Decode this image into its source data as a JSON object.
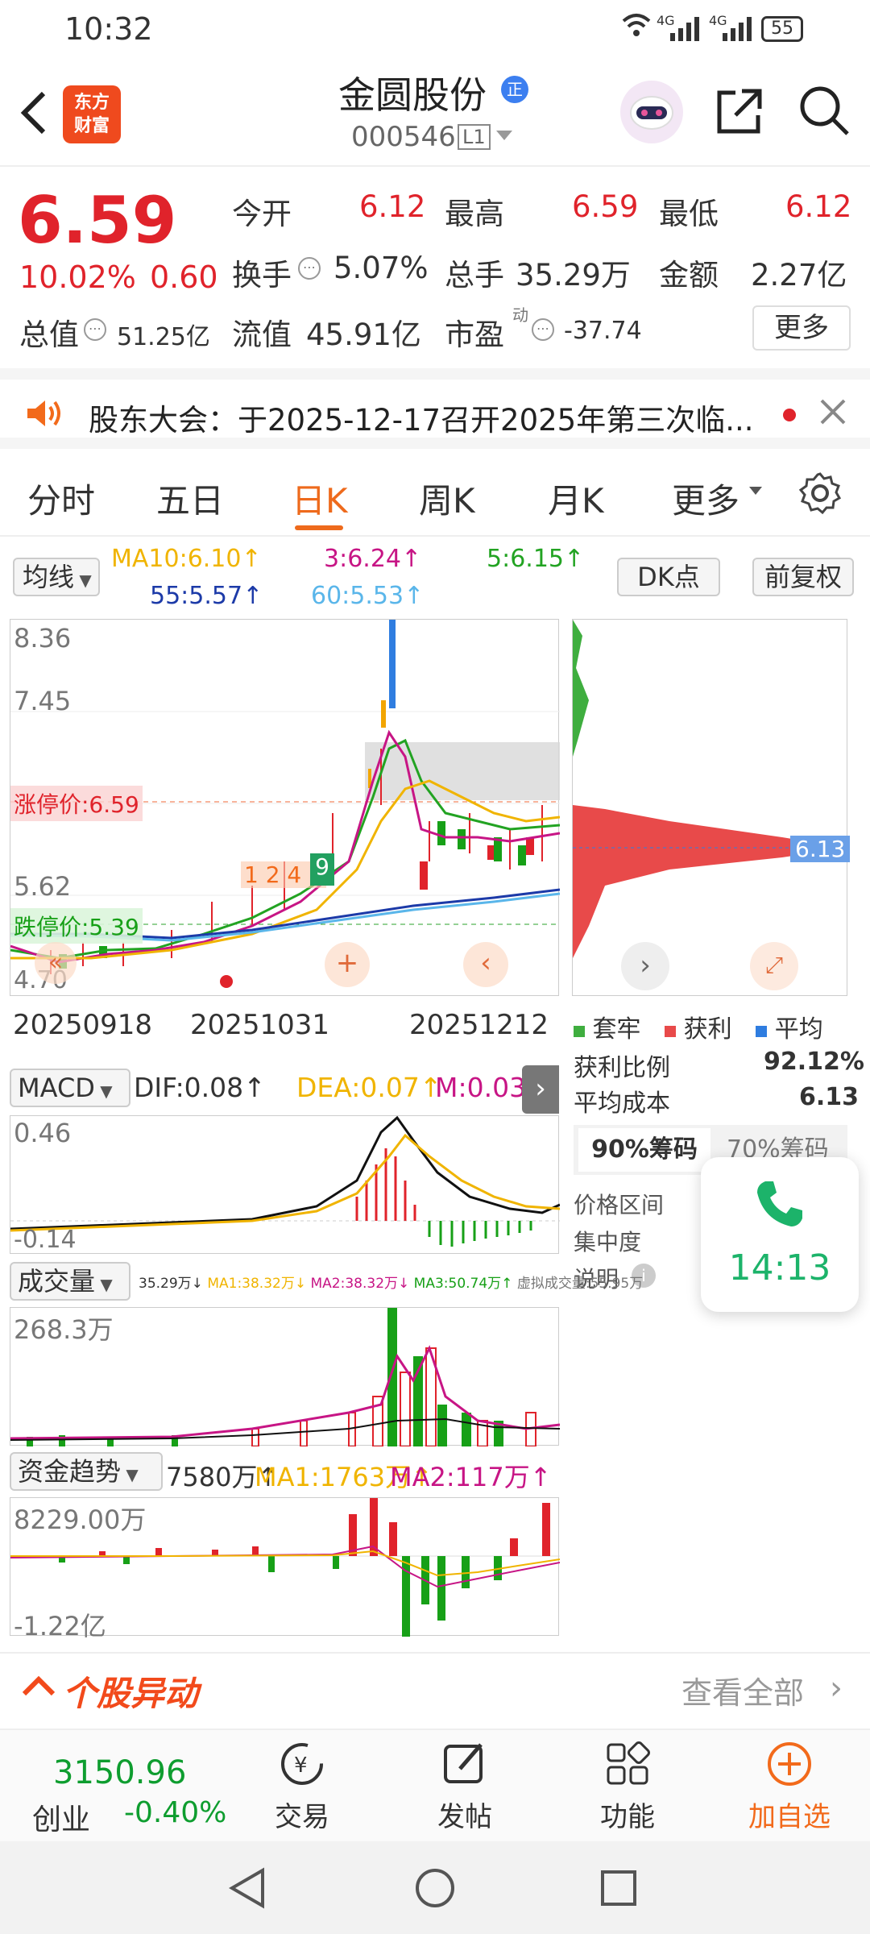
{
  "status": {
    "time": "10:32",
    "battery": "55",
    "net1": "4G",
    "net2": "4G"
  },
  "header": {
    "logo_top": "东方",
    "logo_bottom": "财富",
    "title": "金圆股份",
    "title_badge": "正",
    "code": "000546",
    "level": "L1"
  },
  "quote": {
    "price": "6.59",
    "pct": "10.02%",
    "change": "0.60",
    "open_label": "今开",
    "open": "6.12",
    "high_label": "最高",
    "high": "6.59",
    "low_label": "最低",
    "low": "6.12",
    "turnover_label": "换手",
    "turnover": "5.07%",
    "volume_label": "总手",
    "volume": "35.29万",
    "amount_label": "金额",
    "amount": "2.27亿",
    "mcap_label": "总值",
    "mcap": "51.25亿",
    "float_label": "流值",
    "float": "45.91亿",
    "pe_label": "市盈",
    "pe_sup": "动",
    "pe": "-37.74",
    "more_btn": "更多"
  },
  "notice": {
    "text": "股东大会：于2025-12-17召开2025年第三次临..."
  },
  "tabs": [
    "分时",
    "五日",
    "日K",
    "周K",
    "月K",
    "更多"
  ],
  "kline": {
    "ma_selector": "均线",
    "ma10": "MA10:6.10↑",
    "ma3": "3:6.24↑",
    "ma5": "5:6.15↑",
    "ma55": "55:5.57↑",
    "ma60": "60:5.53↑",
    "dk_btn": "DK点",
    "fq_btn": "前复权",
    "y_labels": [
      "8.36",
      "7.45",
      "5.62",
      "4.70"
    ],
    "limit_up": "涨停价:6.59",
    "limit_down": "跌停价:5.39",
    "dates": [
      "20250918",
      "20251031",
      "20251212"
    ]
  },
  "chips": {
    "cost_tag": "6.13",
    "legend": [
      "套牢",
      "获利",
      "平均"
    ],
    "profit_label": "获利比例",
    "profit": "92.12%",
    "avg_label": "平均成本",
    "avg": "6.13",
    "tab90": "90%筹码",
    "tab70": "70%筹码",
    "range_label": "价格区间",
    "conc_label": "集中度",
    "desc_label": "说明"
  },
  "call": {
    "time": "14:13"
  },
  "macd": {
    "selector": "MACD",
    "dif": "DIF:0.08↑",
    "dea": "DEA:0.07↑",
    "m": "M:0.03↑",
    "top": "0.46",
    "bottom": "-0.14"
  },
  "vol": {
    "selector": "成交量",
    "info": "35.29万↓",
    "ma1": "MA1:38.32万↓",
    "ma2": "MA2:38.32万↓",
    "ma3": "MA3:50.74万↑",
    "virt": "虚拟成交量:55.95万",
    "top": "268.3万"
  },
  "fund": {
    "selector": "资金趋势",
    "val": "7580万↑",
    "ma1": "MA1:1763万↑",
    "ma2": "MA2:117万↑",
    "top": "8229.00万",
    "bottom": "-1.22亿"
  },
  "abnormal": {
    "title": "个股异动",
    "link": "查看全部"
  },
  "bottom_bar": {
    "index_value": "3150.96",
    "index_name": "创业",
    "index_pct": "-0.40%",
    "items": [
      "交易",
      "发帖",
      "功能",
      "加自选"
    ]
  }
}
